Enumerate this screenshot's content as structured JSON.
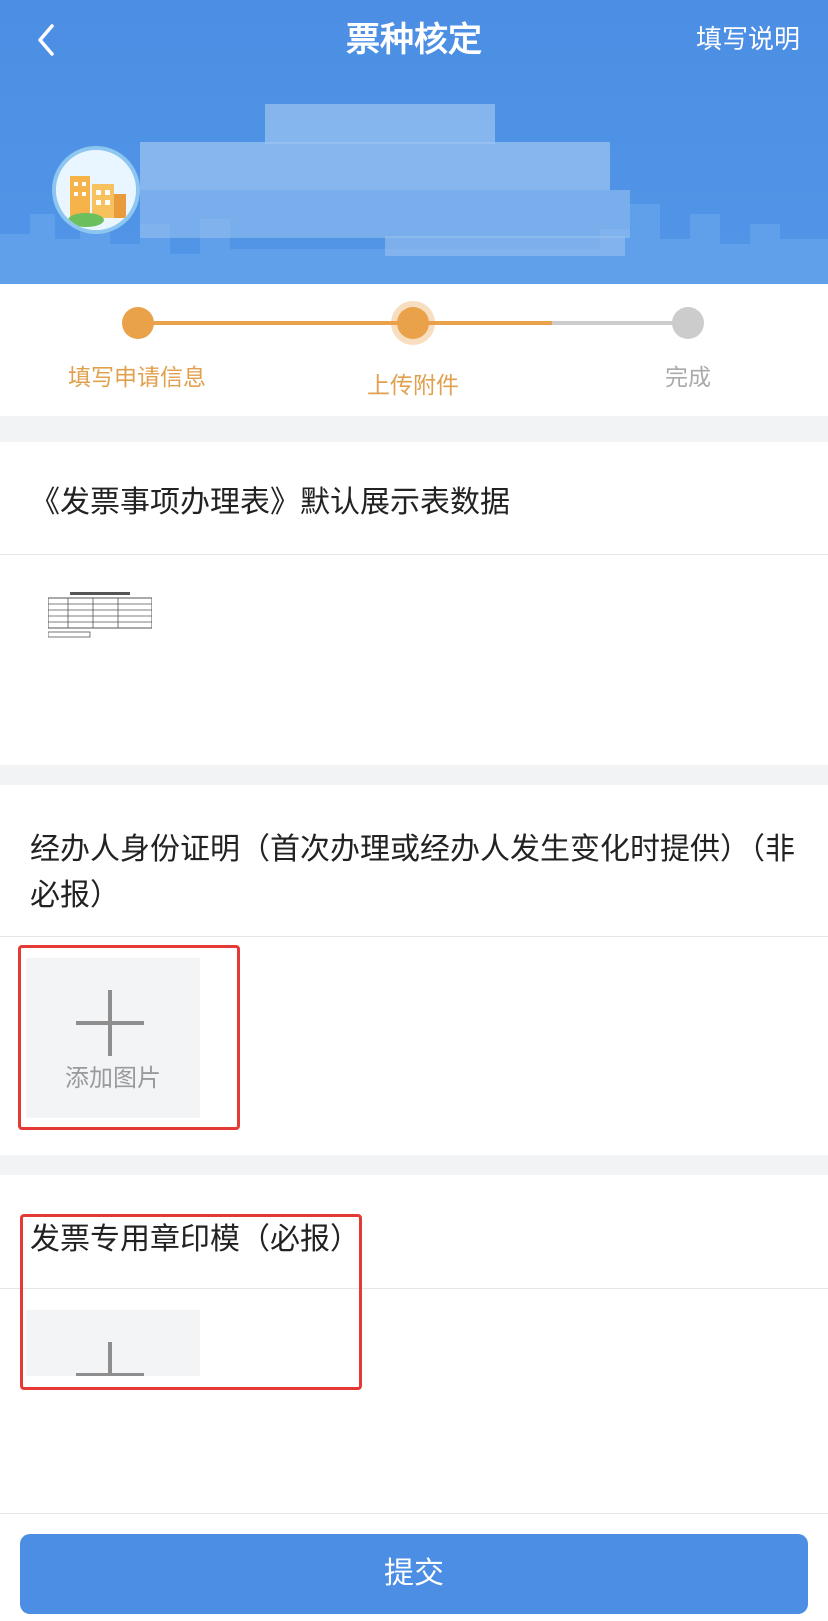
{
  "header": {
    "back_icon": "chevron-left-icon",
    "title": "票种核定",
    "help_label": "填写说明"
  },
  "colors": {
    "primary": "#4b8ee3",
    "step_active": "#e9a14a",
    "step_inactive": "#cccccc",
    "alert_frame": "#e53935"
  },
  "stepper": {
    "steps": [
      {
        "label": "填写申请信息",
        "state": "done"
      },
      {
        "label": "上传附件",
        "state": "current"
      },
      {
        "label": "完成",
        "state": "pending"
      }
    ]
  },
  "sections": [
    {
      "title": "《发票事项办理表》默认展示表数据"
    },
    {
      "title": "经办人身份证明（首次办理或经办人发生变化时提供）（非必报）",
      "add_label": "添加图片"
    },
    {
      "title": "发票专用章印模（必报）"
    }
  ],
  "submit_label": "提交"
}
